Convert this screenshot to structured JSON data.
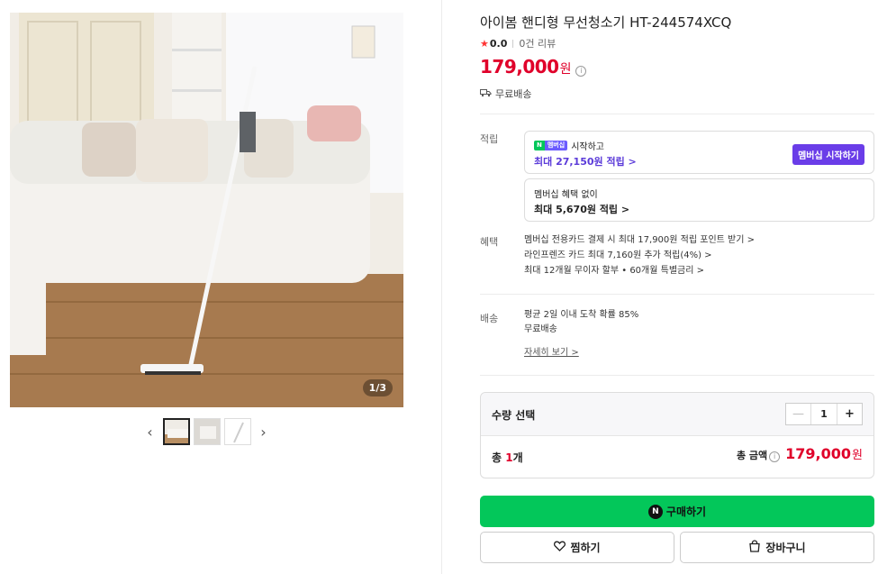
{
  "gallery": {
    "counter": "1/3",
    "prev_arrow": "‹",
    "next_arrow": "›",
    "thumbnail_count": 3,
    "active_index": 0
  },
  "product": {
    "title": "아이봄 핸디형 무선청소기 HT-244574XCQ",
    "rating": "0.0",
    "reviews": "0건 리뷰",
    "price": "179,000",
    "price_unit": "원",
    "shipping": "무료배송"
  },
  "points": {
    "label": "적립",
    "membership_badge_n": "N",
    "membership_badge_plus": "멤버십",
    "membership_start_text": "시작하고",
    "membership_max": "최대 27,150원 적립 >",
    "membership_button": "멤버십 시작하기",
    "no_membership_text": "멤버십 혜택 없이",
    "no_membership_max": "최대 5,670원 적립 >"
  },
  "benefits": {
    "label": "혜택",
    "items": [
      "멤버십 전용카드 결제 시 최대 17,900원 적립 포인트 받기 >",
      "라인프렌즈 카드 최대 7,160원 추가 적립(4%) >",
      "최대 12개월 무이자 할부 • 60개월 특별금리 >"
    ]
  },
  "delivery": {
    "label": "배송",
    "line1": "평균 2일 이내 도착 확률 85%",
    "line2": "무료배송",
    "detail_link": "자세히 보기 >"
  },
  "quantity": {
    "label": "수량 선택",
    "value": "1",
    "minus": "—",
    "plus": "+",
    "total_prefix": "총 ",
    "total_count": "1",
    "total_suffix": "개",
    "total_label": "총 금액",
    "total_price": "179,000",
    "total_unit": "원"
  },
  "actions": {
    "buy": "구매하기",
    "buy_icon": "N",
    "wish": "찜하기",
    "cart": "장바구니"
  },
  "colors": {
    "price_red": "#e0002a",
    "naver_green": "#03c75a",
    "membership_purple": "#6a3de8"
  }
}
